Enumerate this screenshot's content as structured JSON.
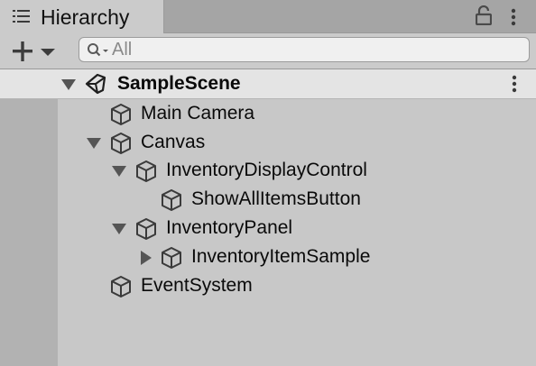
{
  "window": {
    "tab_title": "Hierarchy",
    "tab_icon": "hierarchy-list-icon",
    "lock_icon": "lock-icon",
    "menu_icon": "kebab-menu-icon"
  },
  "toolbar": {
    "create_icon": "plus-icon",
    "create_dropdown_icon": "caret-down-icon",
    "search": {
      "icon": "search-icon",
      "placeholder": "All",
      "value": ""
    }
  },
  "scene": {
    "name": "SampleScene",
    "expanded": true,
    "icon": "unity-scene-icon",
    "menu_icon": "kebab-menu-icon"
  },
  "hierarchy": {
    "items": [
      {
        "label": "Main Camera",
        "depth": 1,
        "foldout": "none"
      },
      {
        "label": "Canvas",
        "depth": 1,
        "foldout": "expanded"
      },
      {
        "label": "InventoryDisplayControl",
        "depth": 2,
        "foldout": "expanded"
      },
      {
        "label": "ShowAllItemsButton",
        "depth": 3,
        "foldout": "none"
      },
      {
        "label": "InventoryPanel",
        "depth": 2,
        "foldout": "expanded"
      },
      {
        "label": "InventoryItemSample",
        "depth": 3,
        "foldout": "collapsed"
      },
      {
        "label": "EventSystem",
        "depth": 1,
        "foldout": "none"
      }
    ]
  },
  "colors": {
    "tab_bar": "#a5a5a5",
    "panel": "#c8c8c8",
    "scene_row": "#e4e4e4",
    "gutter": "#b2b2b2",
    "icon": "#3a3a3a"
  }
}
